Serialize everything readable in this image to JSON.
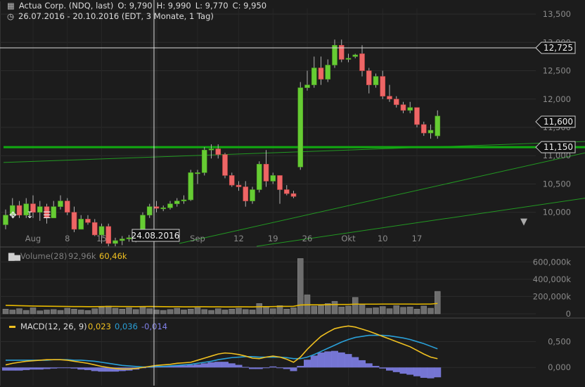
{
  "header": {
    "instrument": "Actua Corp. (NDQ, last)",
    "open": "O: 9,790",
    "high": "H: 9,990",
    "low": "L: 9,770",
    "close": "C: 9,950",
    "range": "26.07.2016 - 20.10.2016 (EDT, 3 Monate, 1 Tag)"
  },
  "crosshair": {
    "date_label": "24.08.2016",
    "price_label": "12,725"
  },
  "volume_panel": {
    "label": "Volume(28)",
    "value1": "92,96k",
    "value2": "60,46k"
  },
  "macd_panel": {
    "label": "MACD(12, 26, 9)",
    "value1": "0,023",
    "value2": "0,036",
    "value3": "-0,014"
  },
  "colors": {
    "background": "#1c1c1c",
    "up": "#66cc33",
    "down": "#ee6666",
    "support": "#11aa11",
    "trend": "#229922",
    "volume": "#6e6e6e",
    "volume_ma": "#e6b800",
    "macd": "#f0c020",
    "signal": "#2aa0d8",
    "histogram": "#8080e8"
  },
  "chart_data": [
    {
      "type": "candlestick",
      "x_tick_labels": [
        "Aug",
        "8",
        "15",
        "Sep",
        "12",
        "19",
        "26",
        "Okt",
        "10",
        "17"
      ],
      "y_tick_labels": [
        "10,000",
        "10,500",
        "11,000",
        "11,500",
        "12,000",
        "12,500",
        "13,000",
        "13,500"
      ],
      "ylim": [
        9.4,
        13.6
      ],
      "price_labels": [
        "12,725",
        "11,600",
        "11,150"
      ],
      "support_level": 11.15,
      "candles": [
        {
          "o": 9.78,
          "h": 10.05,
          "l": 9.7,
          "c": 9.95
        },
        {
          "o": 9.95,
          "h": 10.25,
          "l": 9.9,
          "c": 10.12
        },
        {
          "o": 10.12,
          "h": 10.2,
          "l": 9.9,
          "c": 9.95
        },
        {
          "o": 9.95,
          "h": 10.25,
          "l": 9.9,
          "c": 10.15
        },
        {
          "o": 10.15,
          "h": 10.3,
          "l": 9.9,
          "c": 10.0
        },
        {
          "o": 10.0,
          "h": 10.2,
          "l": 9.85,
          "c": 10.1
        },
        {
          "o": 10.1,
          "h": 10.15,
          "l": 9.8,
          "c": 9.9
        },
        {
          "o": 9.9,
          "h": 10.2,
          "l": 9.9,
          "c": 10.1
        },
        {
          "o": 10.1,
          "h": 10.3,
          "l": 10.05,
          "c": 10.2
        },
        {
          "o": 10.2,
          "h": 10.25,
          "l": 9.95,
          "c": 10.0
        },
        {
          "o": 10.0,
          "h": 10.1,
          "l": 9.65,
          "c": 9.7
        },
        {
          "o": 9.7,
          "h": 9.95,
          "l": 9.7,
          "c": 9.88
        },
        {
          "o": 9.88,
          "h": 9.95,
          "l": 9.78,
          "c": 9.82
        },
        {
          "o": 9.82,
          "h": 9.88,
          "l": 9.58,
          "c": 9.6
        },
        {
          "o": 9.6,
          "h": 9.8,
          "l": 9.45,
          "c": 9.75
        },
        {
          "o": 9.75,
          "h": 9.8,
          "l": 9.4,
          "c": 9.45
        },
        {
          "o": 9.45,
          "h": 9.55,
          "l": 9.4,
          "c": 9.5
        },
        {
          "o": 9.5,
          "h": 9.58,
          "l": 9.42,
          "c": 9.53
        },
        {
          "o": 9.53,
          "h": 9.6,
          "l": 9.48,
          "c": 9.55
        },
        {
          "o": 9.55,
          "h": 9.62,
          "l": 9.47,
          "c": 9.5
        },
        {
          "o": 9.5,
          "h": 10.0,
          "l": 9.5,
          "c": 9.95
        },
        {
          "o": 9.95,
          "h": 10.15,
          "l": 9.9,
          "c": 10.1
        },
        {
          "o": 10.1,
          "h": 10.2,
          "l": 10.0,
          "c": 10.07
        },
        {
          "o": 10.07,
          "h": 10.12,
          "l": 10.02,
          "c": 10.08
        },
        {
          "o": 10.08,
          "h": 10.2,
          "l": 10.05,
          "c": 10.15
        },
        {
          "o": 10.15,
          "h": 10.25,
          "l": 10.1,
          "c": 10.2
        },
        {
          "o": 10.2,
          "h": 10.3,
          "l": 10.15,
          "c": 10.22
        },
        {
          "o": 10.22,
          "h": 10.75,
          "l": 10.2,
          "c": 10.7
        },
        {
          "o": 10.7,
          "h": 10.75,
          "l": 10.5,
          "c": 10.7
        },
        {
          "o": 10.7,
          "h": 11.15,
          "l": 10.65,
          "c": 11.1
        },
        {
          "o": 11.1,
          "h": 11.2,
          "l": 10.95,
          "c": 11.12
        },
        {
          "o": 11.12,
          "h": 11.2,
          "l": 10.95,
          "c": 11.02
        },
        {
          "o": 11.02,
          "h": 11.05,
          "l": 10.6,
          "c": 10.65
        },
        {
          "o": 10.65,
          "h": 10.7,
          "l": 10.45,
          "c": 10.48
        },
        {
          "o": 10.48,
          "h": 10.55,
          "l": 10.38,
          "c": 10.45
        },
        {
          "o": 10.45,
          "h": 10.55,
          "l": 10.1,
          "c": 10.2
        },
        {
          "o": 10.2,
          "h": 10.45,
          "l": 10.15,
          "c": 10.4
        },
        {
          "o": 10.4,
          "h": 10.9,
          "l": 10.35,
          "c": 10.85
        },
        {
          "o": 10.85,
          "h": 11.1,
          "l": 10.45,
          "c": 10.55
        },
        {
          "o": 10.55,
          "h": 10.7,
          "l": 10.5,
          "c": 10.65
        },
        {
          "o": 10.65,
          "h": 10.65,
          "l": 10.15,
          "c": 10.4
        },
        {
          "o": 10.4,
          "h": 10.48,
          "l": 10.3,
          "c": 10.33
        },
        {
          "o": 10.33,
          "h": 10.38,
          "l": 10.25,
          "c": 10.28
        },
        {
          "o": 10.8,
          "h": 12.3,
          "l": 10.75,
          "c": 12.2
        },
        {
          "o": 12.2,
          "h": 12.5,
          "l": 12.15,
          "c": 12.25
        },
        {
          "o": 12.25,
          "h": 12.75,
          "l": 12.2,
          "c": 12.55
        },
        {
          "o": 12.55,
          "h": 12.75,
          "l": 12.25,
          "c": 12.35
        },
        {
          "o": 12.35,
          "h": 12.7,
          "l": 12.3,
          "c": 12.6
        },
        {
          "o": 12.6,
          "h": 13.05,
          "l": 12.55,
          "c": 12.95
        },
        {
          "o": 12.95,
          "h": 13.05,
          "l": 12.65,
          "c": 12.7
        },
        {
          "o": 12.7,
          "h": 12.8,
          "l": 12.65,
          "c": 12.72
        },
        {
          "o": 12.75,
          "h": 12.8,
          "l": 12.72,
          "c": 12.78
        },
        {
          "o": 12.8,
          "h": 12.95,
          "l": 12.4,
          "c": 12.5
        },
        {
          "o": 12.5,
          "h": 12.55,
          "l": 12.1,
          "c": 12.25
        },
        {
          "o": 12.25,
          "h": 12.45,
          "l": 12.2,
          "c": 12.4
        },
        {
          "o": 12.4,
          "h": 12.5,
          "l": 12.0,
          "c": 12.05
        },
        {
          "o": 12.05,
          "h": 12.25,
          "l": 11.95,
          "c": 12.0
        },
        {
          "o": 12.0,
          "h": 12.05,
          "l": 11.85,
          "c": 11.9
        },
        {
          "o": 11.9,
          "h": 11.95,
          "l": 11.75,
          "c": 11.8
        },
        {
          "o": 11.8,
          "h": 11.95,
          "l": 11.75,
          "c": 11.85
        },
        {
          "o": 11.85,
          "h": 11.85,
          "l": 11.5,
          "c": 11.55
        },
        {
          "o": 11.55,
          "h": 11.6,
          "l": 11.35,
          "c": 11.4
        },
        {
          "o": 11.4,
          "h": 11.55,
          "l": 11.3,
          "c": 11.45
        },
        {
          "o": 11.35,
          "h": 11.8,
          "l": 11.3,
          "c": 11.7
        }
      ]
    },
    {
      "type": "bar",
      "series_name": "Volume(28)",
      "y_tick_labels": [
        "0",
        "200,000k",
        "400,000k",
        "600,000k"
      ],
      "ylim": [
        0,
        700
      ],
      "values": [
        55,
        45,
        60,
        40,
        70,
        35,
        45,
        50,
        40,
        65,
        55,
        45,
        38,
        60,
        75,
        90,
        65,
        55,
        70,
        50,
        85,
        60,
        45,
        40,
        50,
        65,
        45,
        55,
        70,
        50,
        40,
        60,
        45,
        55,
        65,
        50,
        45,
        120,
        85,
        60,
        95,
        55,
        70,
        640,
        220,
        90,
        95,
        120,
        145,
        80,
        90,
        190,
        110,
        65,
        70,
        85,
        60,
        95,
        75,
        80,
        55,
        90,
        65,
        260
      ],
      "ma_values": [
        98,
        96,
        94,
        92,
        90,
        89,
        88,
        87,
        86,
        85,
        84,
        84,
        83,
        83,
        84,
        85,
        85,
        84,
        84,
        83,
        84,
        85,
        84,
        83,
        82,
        82,
        81,
        81,
        82,
        82,
        81,
        81,
        80,
        80,
        81,
        81,
        80,
        82,
        83,
        84,
        86,
        86,
        87,
        102,
        104,
        104,
        104,
        106,
        108,
        108,
        108,
        112,
        112,
        112,
        112,
        113,
        113,
        113,
        113,
        113,
        112,
        113,
        113,
        120
      ]
    },
    {
      "type": "line",
      "series_name": "MACD(12, 26, 9)",
      "y_tick_labels": [
        "0,000",
        "0,500"
      ],
      "ylim": [
        -0.35,
        0.9
      ],
      "macd": [
        0.05,
        0.08,
        0.1,
        0.12,
        0.13,
        0.14,
        0.15,
        0.15,
        0.15,
        0.14,
        0.12,
        0.1,
        0.08,
        0.05,
        0.02,
        0.0,
        -0.02,
        -0.03,
        -0.03,
        -0.02,
        0.0,
        0.02,
        0.04,
        0.05,
        0.06,
        0.08,
        0.09,
        0.1,
        0.14,
        0.18,
        0.22,
        0.26,
        0.28,
        0.27,
        0.25,
        0.22,
        0.18,
        0.17,
        0.2,
        0.22,
        0.2,
        0.16,
        0.1,
        0.2,
        0.35,
        0.48,
        0.6,
        0.68,
        0.75,
        0.78,
        0.8,
        0.78,
        0.74,
        0.7,
        0.65,
        0.6,
        0.55,
        0.5,
        0.45,
        0.4,
        0.33,
        0.26,
        0.2,
        0.17
      ],
      "signal": [
        0.14,
        0.14,
        0.14,
        0.14,
        0.14,
        0.14,
        0.14,
        0.15,
        0.15,
        0.15,
        0.14,
        0.14,
        0.13,
        0.12,
        0.1,
        0.08,
        0.06,
        0.04,
        0.03,
        0.02,
        0.01,
        0.01,
        0.02,
        0.02,
        0.03,
        0.04,
        0.05,
        0.06,
        0.08,
        0.1,
        0.12,
        0.15,
        0.17,
        0.19,
        0.2,
        0.21,
        0.21,
        0.2,
        0.2,
        0.2,
        0.2,
        0.19,
        0.17,
        0.17,
        0.2,
        0.25,
        0.31,
        0.37,
        0.43,
        0.49,
        0.54,
        0.58,
        0.6,
        0.62,
        0.62,
        0.62,
        0.61,
        0.59,
        0.57,
        0.54,
        0.5,
        0.46,
        0.41,
        0.36
      ],
      "histogram": [
        -0.06,
        -0.06,
        -0.06,
        -0.05,
        -0.04,
        -0.04,
        -0.03,
        -0.02,
        -0.01,
        -0.01,
        -0.02,
        -0.04,
        -0.05,
        -0.07,
        -0.08,
        -0.08,
        -0.08,
        -0.07,
        -0.06,
        -0.04,
        -0.01,
        0.01,
        0.02,
        0.03,
        0.03,
        0.04,
        0.04,
        0.05,
        0.06,
        0.08,
        0.1,
        0.11,
        0.11,
        0.08,
        0.05,
        0.01,
        -0.03,
        -0.03,
        0.0,
        0.02,
        0.0,
        -0.03,
        -0.07,
        0.03,
        0.15,
        0.23,
        0.29,
        0.31,
        0.32,
        0.29,
        0.26,
        0.2,
        0.14,
        0.08,
        0.03,
        -0.02,
        -0.06,
        -0.09,
        -0.12,
        -0.14,
        -0.17,
        -0.2,
        -0.21,
        -0.19
      ]
    }
  ]
}
